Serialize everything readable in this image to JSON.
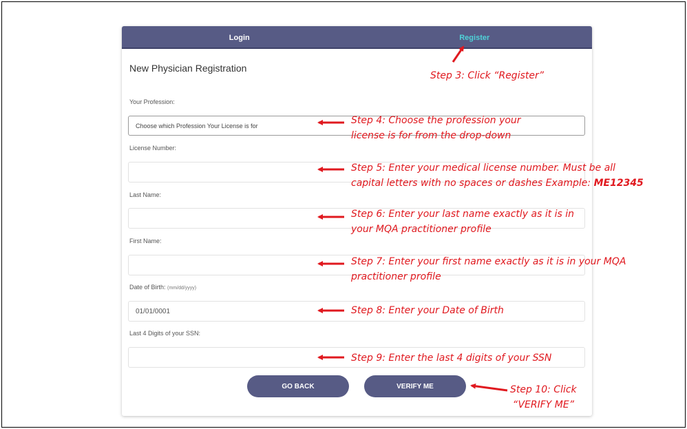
{
  "tabs": {
    "login": "Login",
    "register": "Register"
  },
  "form": {
    "title": "New Physician Registration",
    "profession_label": "Your Profession:",
    "profession_value": "Choose which Profession Your License is for",
    "license_label": "License Number:",
    "license_value": "",
    "last_name_label": "Last Name:",
    "last_name_value": "",
    "first_name_label": "First Name:",
    "first_name_value": "",
    "dob_label": "Date of Birth:",
    "dob_hint": "(mm/dd/yyyy)",
    "dob_value": "01/01/0001",
    "ssn_label": "Last 4 Digits of your SSN:",
    "ssn_value": ""
  },
  "buttons": {
    "go_back": "GO BACK",
    "verify": "VERIFY ME"
  },
  "annotations": {
    "step3": "Step 3: Click “Register”",
    "step4_line1": "Step 4: Choose the profession your",
    "step4_line2": "license is for from the drop-down",
    "step5_line1": "Step 5: Enter your medical license number. Must be all",
    "step5_line2": "capital letters with no spaces or dashes Example:",
    "step5_example": "ME12345",
    "step6_line1": "Step 6: Enter your last name exactly as it is in",
    "step6_line2": "your MQA practitioner profile",
    "step7_line1": "Step 7: Enter your first name exactly as it is in your MQA",
    "step7_line2": "practitioner profile",
    "step8": "Step 8: Enter your Date of Birth",
    "step9": "Step 9: Enter the last 4 digits of your SSN",
    "step10_line1": "Step 10: Click",
    "step10_line2": "“VERIFY ME”"
  },
  "colors": {
    "header": "#575b85",
    "active_tab": "#4fd2d8",
    "annotation": "#e0191f"
  }
}
